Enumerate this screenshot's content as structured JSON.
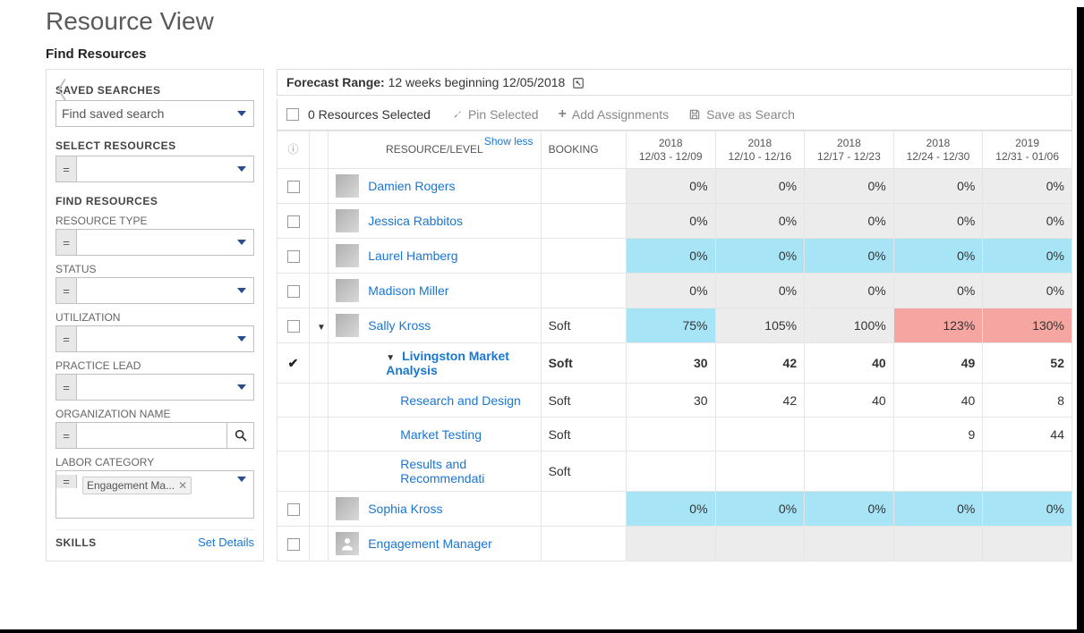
{
  "page": {
    "title": "Resource View",
    "subtitle": "Find Resources"
  },
  "sidebar": {
    "saved_searches_label": "SAVED SEARCHES",
    "saved_searches_placeholder": "Find saved search",
    "select_resources_label": "SELECT RESOURCES",
    "find_resources_label": "FIND RESOURCES",
    "resource_type_label": "RESOURCE TYPE",
    "status_label": "STATUS",
    "utilization_label": "UTILIZATION",
    "practice_lead_label": "PRACTICE LEAD",
    "org_name_label": "ORGANIZATION NAME",
    "labor_category_label": "LABOR CATEGORY",
    "labor_category_token": "Engagement Ma...",
    "skills_label": "SKILLS",
    "set_details": "Set Details"
  },
  "forecast": {
    "label": "Forecast Range:",
    "value": "12 weeks beginning 12/05/2018"
  },
  "toolbar": {
    "selected": "0 Resources Selected",
    "pin": "Pin Selected",
    "add": "Add Assignments",
    "save": "Save as Search"
  },
  "table": {
    "headers": {
      "resource": "RESOURCE/LEVEL",
      "booking": "BOOKING",
      "showless": "Show less"
    },
    "weeks": [
      {
        "year": "2018",
        "range": "12/03 - 12/09"
      },
      {
        "year": "2018",
        "range": "12/10 - 12/16"
      },
      {
        "year": "2018",
        "range": "12/17 - 12/23"
      },
      {
        "year": "2018",
        "range": "12/24 - 12/30"
      },
      {
        "year": "2019",
        "range": "12/31 - 01/06"
      }
    ],
    "rows": [
      {
        "type": "res",
        "name": "Damien Rogers",
        "booking": "",
        "cells": [
          {
            "v": "0%",
            "c": "gray"
          },
          {
            "v": "0%",
            "c": "gray"
          },
          {
            "v": "0%",
            "c": "gray"
          },
          {
            "v": "0%",
            "c": "gray"
          },
          {
            "v": "0%",
            "c": "gray"
          }
        ]
      },
      {
        "type": "res",
        "name": "Jessica Rabbitos",
        "booking": "",
        "cells": [
          {
            "v": "0%",
            "c": "gray"
          },
          {
            "v": "0%",
            "c": "gray"
          },
          {
            "v": "0%",
            "c": "gray"
          },
          {
            "v": "0%",
            "c": "gray"
          },
          {
            "v": "0%",
            "c": "gray"
          }
        ]
      },
      {
        "type": "res",
        "name": "Laurel Hamberg",
        "booking": "",
        "cells": [
          {
            "v": "0%",
            "c": "blue"
          },
          {
            "v": "0%",
            "c": "blue"
          },
          {
            "v": "0%",
            "c": "blue"
          },
          {
            "v": "0%",
            "c": "blue"
          },
          {
            "v": "0%",
            "c": "blue"
          }
        ]
      },
      {
        "type": "res",
        "name": "Madison Miller",
        "booking": "",
        "cells": [
          {
            "v": "0%",
            "c": "gray"
          },
          {
            "v": "0%",
            "c": "gray"
          },
          {
            "v": "0%",
            "c": "gray"
          },
          {
            "v": "0%",
            "c": "gray"
          },
          {
            "v": "0%",
            "c": "gray"
          }
        ]
      },
      {
        "type": "res",
        "name": "Sally Kross",
        "booking": "Soft",
        "expandable": true,
        "cells": [
          {
            "v": "75%",
            "c": "blue"
          },
          {
            "v": "105%",
            "c": "gray"
          },
          {
            "v": "100%",
            "c": "gray"
          },
          {
            "v": "123%",
            "c": "red"
          },
          {
            "v": "130%",
            "c": "red"
          }
        ]
      },
      {
        "type": "proj",
        "name": "Livingston Market Analysis",
        "booking": "Soft",
        "cells": [
          {
            "v": "30"
          },
          {
            "v": "42"
          },
          {
            "v": "40"
          },
          {
            "v": "49"
          },
          {
            "v": "52"
          }
        ]
      },
      {
        "type": "task",
        "name": "Research and Design",
        "booking": "Soft",
        "cells": [
          {
            "v": "30"
          },
          {
            "v": "42"
          },
          {
            "v": "40"
          },
          {
            "v": "40"
          },
          {
            "v": "8"
          }
        ]
      },
      {
        "type": "task",
        "name": "Market Testing",
        "booking": "Soft",
        "cells": [
          {
            "v": ""
          },
          {
            "v": ""
          },
          {
            "v": ""
          },
          {
            "v": "9"
          },
          {
            "v": "44"
          }
        ]
      },
      {
        "type": "task",
        "name": "Results and Recommendati",
        "booking": "Soft",
        "cells": [
          {
            "v": ""
          },
          {
            "v": ""
          },
          {
            "v": ""
          },
          {
            "v": ""
          },
          {
            "v": ""
          }
        ]
      },
      {
        "type": "res",
        "name": "Sophia Kross",
        "booking": "",
        "cells": [
          {
            "v": "0%",
            "c": "blue"
          },
          {
            "v": "0%",
            "c": "blue"
          },
          {
            "v": "0%",
            "c": "blue"
          },
          {
            "v": "0%",
            "c": "blue"
          },
          {
            "v": "0%",
            "c": "blue"
          }
        ]
      },
      {
        "type": "res",
        "name": "Engagement Manager",
        "booking": "",
        "placeholder": true,
        "cells": [
          {
            "v": "",
            "c": "gray"
          },
          {
            "v": "",
            "c": "gray"
          },
          {
            "v": "",
            "c": "gray"
          },
          {
            "v": "",
            "c": "gray"
          },
          {
            "v": "",
            "c": "gray"
          }
        ]
      }
    ]
  }
}
